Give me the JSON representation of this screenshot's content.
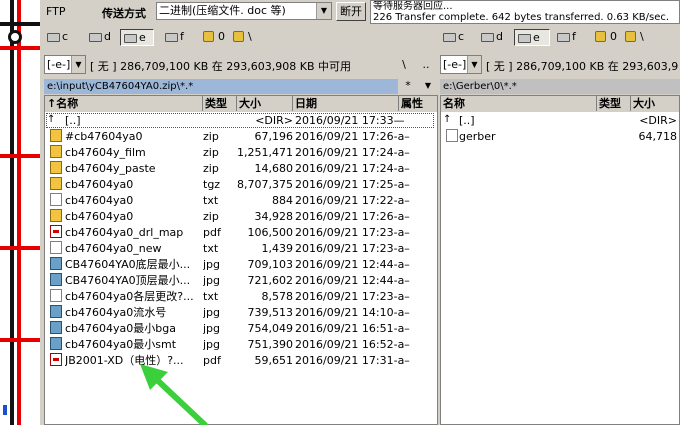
{
  "ftp_bar": {
    "ftp_label": "FTP",
    "mode_label": "传送方式",
    "mode_value": "二进制(压缩文件. doc 等)",
    "disconnect_label": "断开",
    "log_lines": [
      "等待服务器回应...",
      "226 Transfer complete. 642 bytes transferred. 0.63 KB/sec."
    ]
  },
  "left_panel": {
    "drives": [
      {
        "label": "c",
        "active": false
      },
      {
        "label": "d",
        "active": false
      },
      {
        "label": "e",
        "active": true
      },
      {
        "label": "f",
        "active": false
      },
      {
        "label": "0",
        "active": false
      }
    ],
    "root_label": "\\",
    "drive_combo": "[-e-]",
    "free_info": "[ 无 ]  286,709,100 KB 在 293,603,908 KB 中可用",
    "root_btn": "\\",
    "parent_btn": "..",
    "filter_btn": "*",
    "path": "e:\\input\\yCB47604YA0.zip\\*.*",
    "columns": {
      "name": "↑名称",
      "ext": "类型",
      "size": "大小",
      "date": "日期",
      "attr": "属性"
    },
    "files": [
      {
        "icon": "up",
        "name": "[..]",
        "ext": "",
        "size": "<DIR>",
        "date": "2016/09/21 17:33—",
        "attr": ""
      },
      {
        "icon": "zip",
        "name": "#cb47604ya0",
        "ext": "zip",
        "size": "67,196",
        "date": "2016/09/21 17:26-a–",
        "attr": ""
      },
      {
        "icon": "zip",
        "name": "cb47604y_film",
        "ext": "zip",
        "size": "1,251,471",
        "date": "2016/09/21 17:24-a–",
        "attr": ""
      },
      {
        "icon": "zip",
        "name": "cb47604y_paste",
        "ext": "zip",
        "size": "14,680",
        "date": "2016/09/21 17:24-a–",
        "attr": ""
      },
      {
        "icon": "zip",
        "name": "cb47604ya0",
        "ext": "tgz",
        "size": "8,707,375",
        "date": "2016/09/21 17:25-a–",
        "attr": ""
      },
      {
        "icon": "txt",
        "name": "cb47604ya0",
        "ext": "txt",
        "size": "884",
        "date": "2016/09/21 17:22-a–",
        "attr": ""
      },
      {
        "icon": "zip",
        "name": "cb47604ya0",
        "ext": "zip",
        "size": "34,928",
        "date": "2016/09/21 17:26-a–",
        "attr": ""
      },
      {
        "icon": "pdf",
        "name": "cb47604ya0_drl_map",
        "ext": "pdf",
        "size": "106,500",
        "date": "2016/09/21 17:23-a–",
        "attr": ""
      },
      {
        "icon": "txt",
        "name": "cb47604ya0_new",
        "ext": "txt",
        "size": "1,439",
        "date": "2016/09/21 17:23-a–",
        "attr": ""
      },
      {
        "icon": "jpg",
        "name": "CB47604YA0底层最小...",
        "ext": "jpg",
        "size": "709,103",
        "date": "2016/09/21 12:44-a–",
        "attr": ""
      },
      {
        "icon": "jpg",
        "name": "CB47604YA0顶层最小...",
        "ext": "jpg",
        "size": "721,602",
        "date": "2016/09/21 12:44-a–",
        "attr": ""
      },
      {
        "icon": "txt",
        "name": "cb47604ya0各层更改?...",
        "ext": "txt",
        "size": "8,578",
        "date": "2016/09/21 17:23-a–",
        "attr": ""
      },
      {
        "icon": "jpg",
        "name": "cb47604ya0流水号",
        "ext": "jpg",
        "size": "739,513",
        "date": "2016/09/21 14:10-a–",
        "attr": ""
      },
      {
        "icon": "jpg",
        "name": "cb47604ya0最小bga",
        "ext": "jpg",
        "size": "754,049",
        "date": "2016/09/21 16:51-a–",
        "attr": ""
      },
      {
        "icon": "jpg",
        "name": "cb47604ya0最小smt",
        "ext": "jpg",
        "size": "751,390",
        "date": "2016/09/21 16:52-a–",
        "attr": ""
      },
      {
        "icon": "pdf",
        "name": "JB2001-XD（电性）?...",
        "ext": "pdf",
        "size": "59,651",
        "date": "2016/09/21 17:31-a–",
        "attr": ""
      }
    ]
  },
  "right_panel": {
    "drives": [
      {
        "label": "c",
        "active": false
      },
      {
        "label": "d",
        "active": false
      },
      {
        "label": "e",
        "active": true
      },
      {
        "label": "f",
        "active": false
      },
      {
        "label": "0",
        "active": false
      }
    ],
    "root_label": "\\",
    "drive_combo": "[-e-]",
    "free_info": "[ 无 ]  286,709,100 KB 在 293,603,9",
    "path": "e:\\Gerber\\0\\*.*",
    "columns": {
      "name": "名称",
      "ext": "类型",
      "size": "大小"
    },
    "files": [
      {
        "icon": "up",
        "name": "[..]",
        "ext": "",
        "size": "<DIR>"
      },
      {
        "icon": "txt",
        "name": "gerber",
        "ext": "",
        "size": "64,718"
      }
    ]
  }
}
